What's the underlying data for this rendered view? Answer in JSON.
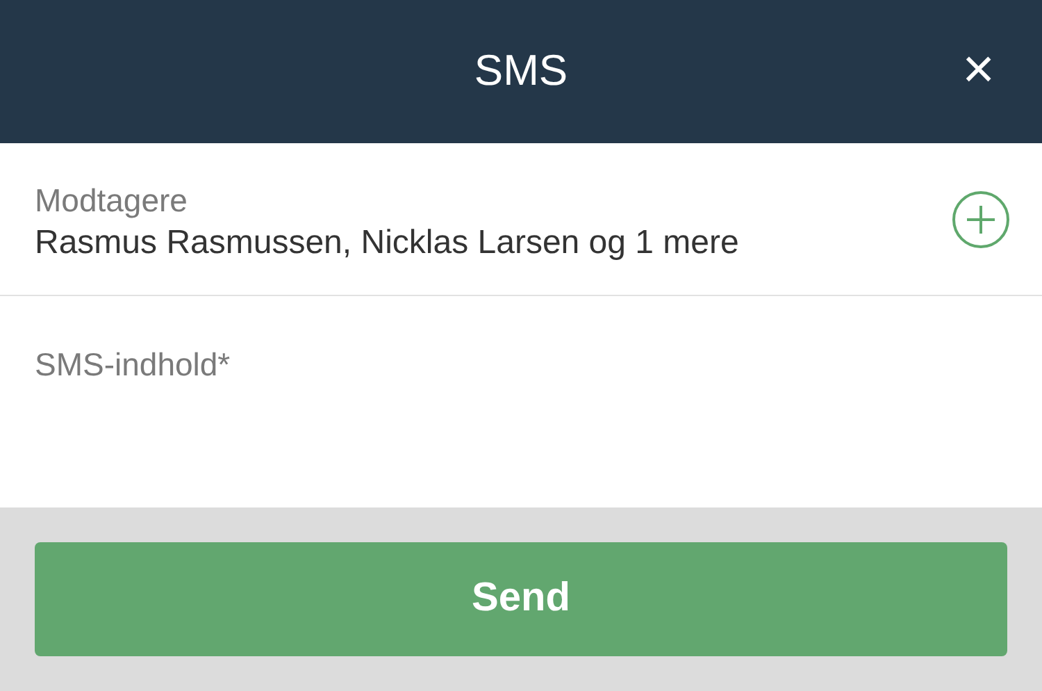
{
  "header": {
    "title": "SMS",
    "close": "×"
  },
  "recipients": {
    "label": "Modtagere",
    "value": "Rasmus Rasmussen, Nicklas Larsen og 1 mere"
  },
  "message": {
    "placeholder": "SMS-indhold*"
  },
  "send_button": {
    "label": "Send"
  }
}
